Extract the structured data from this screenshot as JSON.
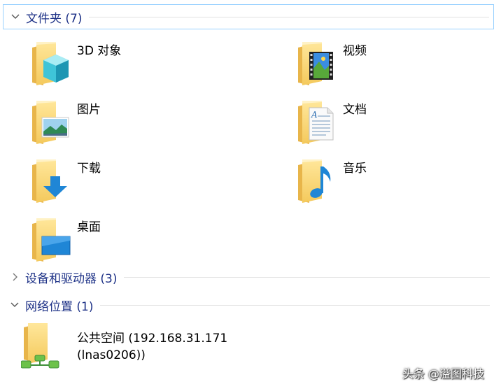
{
  "groups": {
    "folders": {
      "title": "文件夹 (7)",
      "expanded": true
    },
    "devices": {
      "title": "设备和驱动器 (3)",
      "expanded": false
    },
    "network": {
      "title": "网络位置 (1)",
      "expanded": true
    }
  },
  "folders": [
    {
      "label": "3D 对象",
      "icon": "3d-objects-icon"
    },
    {
      "label": "视频",
      "icon": "videos-icon"
    },
    {
      "label": "图片",
      "icon": "pictures-icon"
    },
    {
      "label": "文档",
      "icon": "documents-icon"
    },
    {
      "label": "下载",
      "icon": "downloads-icon"
    },
    {
      "label": "音乐",
      "icon": "music-icon"
    },
    {
      "label": "桌面",
      "icon": "desktop-icon"
    }
  ],
  "network_location": {
    "line1": "公共空间 (192.168.31.171",
    "line2": "(lnas0206))",
    "icon": "network-location-icon"
  },
  "watermark": "头条 @溢图科技",
  "colors": {
    "group_title": "#1e3287",
    "selection_border": "#99d1ff",
    "folder_yellow": "#f8d775",
    "folder_back": "#e7b94c"
  }
}
